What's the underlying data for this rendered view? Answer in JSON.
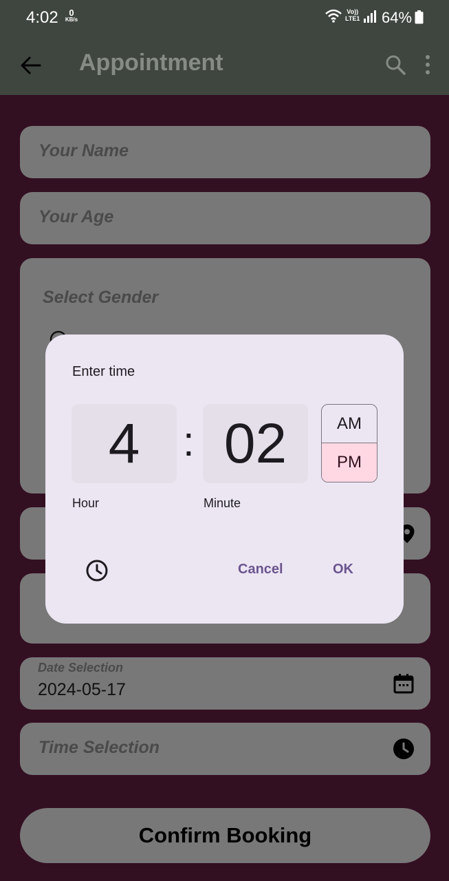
{
  "status_bar": {
    "time": "4:02",
    "net_speed_value": "0",
    "net_speed_unit": "KB/s",
    "volte_top": "Vo))",
    "volte_bottom": "LTE1",
    "battery": "64%"
  },
  "app_bar": {
    "title": "Appointment",
    "icons": [
      "back-arrow-icon",
      "search-icon",
      "more-vert-icon"
    ]
  },
  "form": {
    "name_placeholder": "Your Name",
    "age_placeholder": "Your Age",
    "gender_label": "Select Gender",
    "date_label": "Date Selection",
    "date_value": "2024-05-17",
    "time_placeholder": "Time Selection",
    "confirm_label": "Confirm Booking"
  },
  "dialog": {
    "title": "Enter time",
    "hour": "4",
    "minute": "02",
    "separator": ":",
    "am": "AM",
    "pm": "PM",
    "selected_period": "PM",
    "hour_caption": "Hour",
    "minute_caption": "Minute",
    "cancel": "Cancel",
    "ok": "OK"
  },
  "colors": {
    "background": "#330f22",
    "app_bar": "#3f463f",
    "field": "#787878",
    "dialog": "#ece6f3",
    "pm_selected": "#ffd8e4",
    "dialog_button": "#6a558f"
  }
}
